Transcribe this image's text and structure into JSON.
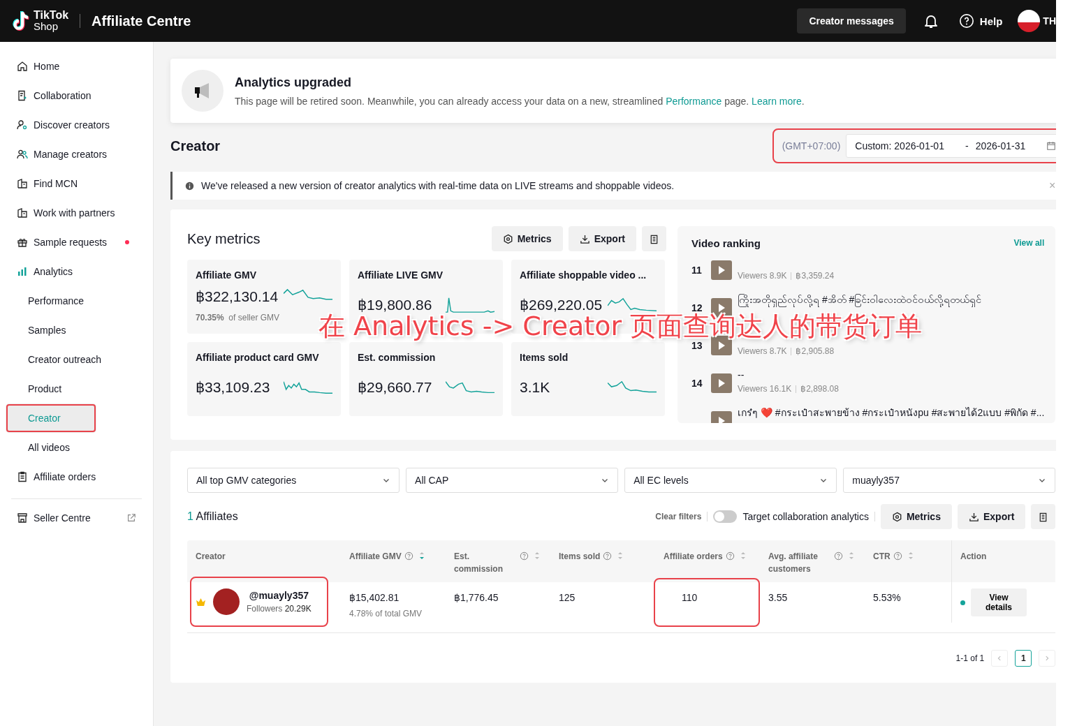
{
  "header": {
    "brand_top": "TikTok",
    "brand_bottom": "Shop",
    "title": "Affiliate Centre",
    "messages_button": "Creator messages",
    "help": "Help",
    "account": "TH"
  },
  "sidebar": {
    "items": [
      {
        "label": "Home",
        "selected": false,
        "dot": false
      },
      {
        "label": "Collaboration",
        "selected": false,
        "dot": false
      },
      {
        "label": "Discover creators",
        "selected": false,
        "dot": false
      },
      {
        "label": "Manage creators",
        "selected": false,
        "dot": false
      },
      {
        "label": "Find MCN",
        "selected": false,
        "dot": false
      },
      {
        "label": "Work with partners",
        "selected": false,
        "dot": false
      },
      {
        "label": "Sample requests",
        "selected": false,
        "dot": true
      },
      {
        "label": "Analytics",
        "selected": false,
        "dot": false,
        "expanded": true,
        "children": [
          {
            "label": "Performance",
            "selected": false,
            "highlighted": false
          },
          {
            "label": "Samples",
            "selected": false,
            "highlighted": false
          },
          {
            "label": "Creator outreach",
            "selected": false,
            "highlighted": false
          },
          {
            "label": "Product",
            "selected": false,
            "highlighted": false
          },
          {
            "label": "Creator",
            "selected": true,
            "highlighted": true
          },
          {
            "label": "All videos",
            "selected": false,
            "highlighted": false
          }
        ]
      },
      {
        "label": "Affiliate orders",
        "selected": false,
        "dot": false
      }
    ],
    "footer_link": "Seller Centre"
  },
  "banner": {
    "title": "Analytics upgraded",
    "text_before": "This page will be retired soon. Meanwhile, you can already access your data on a new, streamlined ",
    "link_1": "Performance",
    "text_middle": " page. ",
    "link_2": "Learn more",
    "text_after": "."
  },
  "page_title": "Creator",
  "date_filter": {
    "timezone": "(GMT+07:00)",
    "start": "Custom: 2026-01-01",
    "separator": "-",
    "end": "2026-01-31",
    "highlighted": true
  },
  "notice": {
    "text": "We've released a new version of creator analytics with real-time data on LIVE streams and shoppable videos.",
    "close": "×"
  },
  "key_metrics": {
    "title": "Key metrics",
    "metrics_button": "Metrics",
    "export_button": "Export",
    "cards": [
      {
        "label": "Affiliate GMV",
        "value": "฿322,130.14",
        "share": "70.35%",
        "share_text": "of seller GMV"
      },
      {
        "label": "Affiliate LIVE GMV",
        "value": "฿19,800.86"
      },
      {
        "label": "Affiliate shoppable video ...",
        "value": "฿269,220.05"
      },
      {
        "label": "Affiliate product card GMV",
        "value": "฿33,109.23"
      },
      {
        "label": "Est. commission",
        "value": "฿29,660.77"
      },
      {
        "label": "Items sold",
        "value": "3.1K"
      }
    ]
  },
  "video_ranking": {
    "title": "Video ranking",
    "view_all": "View all",
    "videos": [
      {
        "rank": "11",
        "viewers": "Viewers 8.9K",
        "amount": "฿3,359.24"
      },
      {
        "rank": "12",
        "title": "ကြိုးအတိုရှည်လုပ်လို့ရ #အိတ် #ခြင်းဝါလေးထဲဝင်ဝယ်လို့ရတယ်ရှင်"
      },
      {
        "rank": "13",
        "viewers": "Viewers 8.7K",
        "amount": "฿2,905.88"
      },
      {
        "rank": "14",
        "title": "--",
        "viewers": "Viewers 16.1K",
        "amount": "฿2,898.08"
      },
      {
        "title": "เกร๋ๆ ❤️ #กระเป๋าสะพายข้าง #กระเป๋าหนังpu #สะพายได้2แบบ #พิกัด #..."
      }
    ]
  },
  "filters": [
    "All top GMV categories",
    "All CAP",
    "All EC levels",
    "muayly357"
  ],
  "affiliates": {
    "count": "1",
    "label": "Affiliates",
    "clear_filters": "Clear filters",
    "toggle": {
      "label": "Target collaboration analytics",
      "on": false
    },
    "metrics_button": "Metrics",
    "export_button": "Export"
  },
  "table": {
    "columns": [
      {
        "label": "Creator",
        "help": false,
        "sortable": false
      },
      {
        "label": "Affiliate GMV",
        "help": true,
        "sortable": true,
        "sorted": true
      },
      {
        "label": "Est. commission",
        "help": true,
        "sortable": true,
        "sorted": false
      },
      {
        "label": "Items sold",
        "help": true,
        "sortable": true,
        "sorted": false
      },
      {
        "label": "Affiliate orders",
        "help": true,
        "sortable": true,
        "sorted": false
      },
      {
        "label": "Avg. affiliate customers",
        "help": true,
        "sortable": true,
        "sorted": false
      },
      {
        "label": "CTR",
        "help": true,
        "sortable": true,
        "sorted": false
      },
      {
        "label": "Action",
        "help": false,
        "sortable": false
      }
    ],
    "rows": [
      {
        "handle": "@muayly357",
        "followers_label": "Followers",
        "followers": "20.29K",
        "creator_highlighted": true,
        "gmv": "฿15,402.81",
        "gmv_share": "4.78% of total GMV",
        "commission": "฿1,776.45",
        "items_sold": "125",
        "orders": "110",
        "orders_highlighted": true,
        "customers": "3.55",
        "ctr": "5.53%",
        "color": "#14a39a",
        "action": "View details"
      }
    ]
  },
  "pagination": {
    "range": "1-1 of 1",
    "pages": [
      {
        "label": "1",
        "selected": true
      }
    ]
  },
  "annotation": "在 Analytics -> Creator 页面查询达人的带货订单"
}
